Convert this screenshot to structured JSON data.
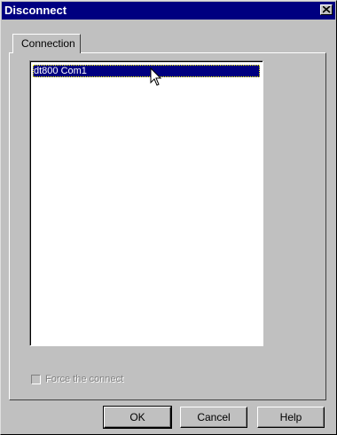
{
  "window": {
    "title": "Disconnect"
  },
  "tabs": [
    {
      "label": "Connection"
    }
  ],
  "connections": [
    {
      "label": "dt800 Com1",
      "selected": true
    }
  ],
  "force_connect": {
    "label": "Force the connect",
    "checked": false,
    "enabled": false
  },
  "buttons": {
    "ok": "OK",
    "cancel": "Cancel",
    "help": "Help"
  },
  "colors": {
    "titlebar": "#000080",
    "face": "#c0c0c0",
    "selection": "#000080"
  },
  "icons": {
    "close": "close-icon",
    "cursor": "mouse-pointer-icon"
  }
}
